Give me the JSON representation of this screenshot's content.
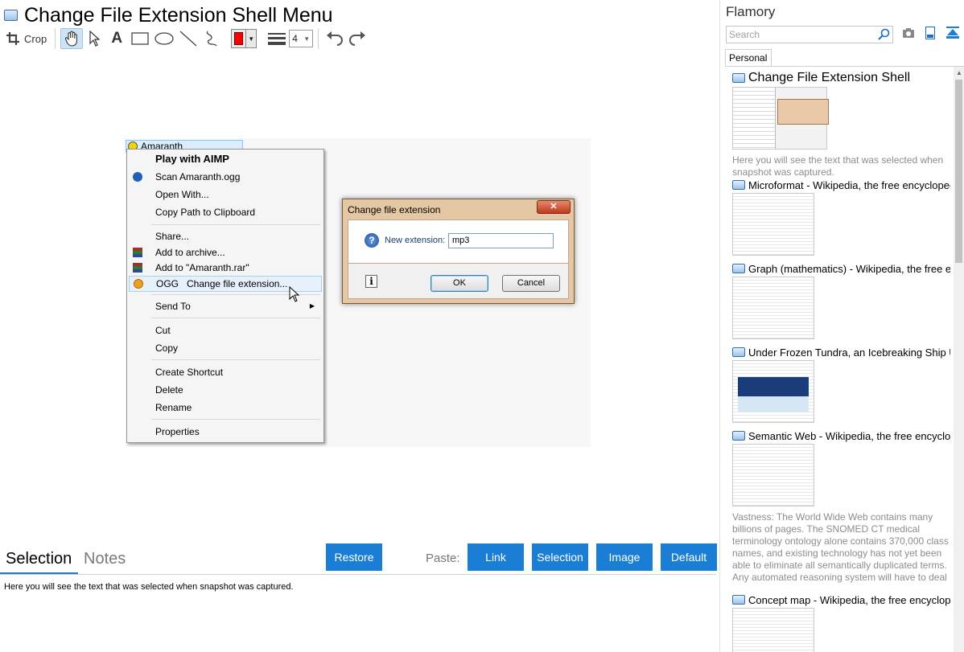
{
  "window": {
    "title": "Change File Extension Shell Menu"
  },
  "toolbar": {
    "crop_label": "Crop",
    "color": "#ff0000",
    "line_width": "4"
  },
  "screenshot": {
    "file_label": "Amaranth",
    "context_menu": {
      "items": [
        "Play with AIMP",
        "Scan Amaranth.ogg",
        "Open With...",
        "Copy Path to Clipboard",
        "Share...",
        "Add to archive...",
        "Add to \"Amaranth.rar\"",
        "OGG   Change file extension...",
        "Send To",
        "Cut",
        "Copy",
        "Create Shortcut",
        "Delete",
        "Rename",
        "Properties"
      ]
    },
    "dialog": {
      "title": "Change file extension",
      "close_glyph": "✕",
      "label": "New extension:",
      "value": "mp3",
      "ok": "OK",
      "cancel": "Cancel"
    }
  },
  "bottom": {
    "tabs": [
      "Selection",
      "Notes"
    ],
    "restore": "Restore",
    "paste_label": "Paste:",
    "paste_buttons": [
      "Link",
      "Selection",
      "Image",
      "Default"
    ],
    "selection_text": "Here you will see the text that was selected when snapshot was captured."
  },
  "sidebar": {
    "title": "Flamory",
    "search_placeholder": "Search",
    "tab": "Personal",
    "cards": [
      {
        "title": "Change File Extension Shell",
        "desc": "Here you will see the text that was selected when snapshot was captured."
      },
      {
        "title": "Microformat - Wikipedia, the free encyclopedia"
      },
      {
        "title": "Graph (mathematics) - Wikipedia, the free encyclopedia"
      },
      {
        "title": "Under Frozen Tundra, an Icebreaking Ship Uncovers..."
      },
      {
        "title": "Semantic Web - Wikipedia, the free encyclopedia",
        "desc": "Vastness: The World Wide Web contains many billions of pages. The SNOMED CT medical terminology ontology alone contains 370,000 class names, and existing technology has not yet been able to eliminate all semantically duplicated terms. Any automated reasoning system will have to deal with truly huge inputs."
      },
      {
        "title": "Concept map - Wikipedia, the free encyclopedia"
      }
    ]
  }
}
